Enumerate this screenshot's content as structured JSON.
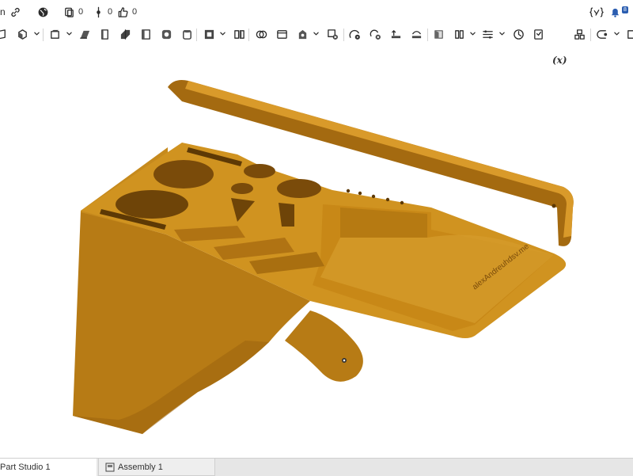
{
  "topbar": {
    "left_fragment": "n",
    "documents_count": "0",
    "branch_count": "0",
    "likes_count": "0",
    "icons": [
      "link-icon",
      "globe-icon",
      "copy-doc-icon",
      "branch-icon",
      "thumbs-up-icon",
      "variable-icon",
      "notification-icon"
    ]
  },
  "toolbar": {
    "fx_label": "(x)",
    "tools": [
      "sketch-icon",
      "extrude-icon",
      "revolve-icon",
      "sweep-icon",
      "loft-icon",
      "thicken-icon",
      "enclose-icon",
      "fillet-icon",
      "chamfer-icon",
      "draft-icon",
      "shell-icon",
      "hole-icon",
      "boolean-icon",
      "split-icon",
      "transform-icon",
      "pattern-icon",
      "mirror-icon",
      "delete-part-icon",
      "modify-fillet-icon",
      "move-face-icon",
      "replace-face-icon",
      "offset-surface-icon",
      "plane-icon",
      "mate-connector-icon",
      "helix-icon",
      "fit-spline-icon",
      "measure-icon",
      "variable-icon",
      "configuration-icon",
      "feature-script-icon"
    ]
  },
  "model": {
    "color": "#c98a17",
    "engraving": "alexAndreuhdsv.me"
  },
  "tabs": [
    {
      "label": "Part Studio 1"
    },
    {
      "label": "Assembly 1"
    }
  ],
  "colors": {
    "accent": "#2a5db0",
    "model_base": "#c98a17",
    "model_dark": "#8f5c0c",
    "model_light": "#e3a532"
  }
}
